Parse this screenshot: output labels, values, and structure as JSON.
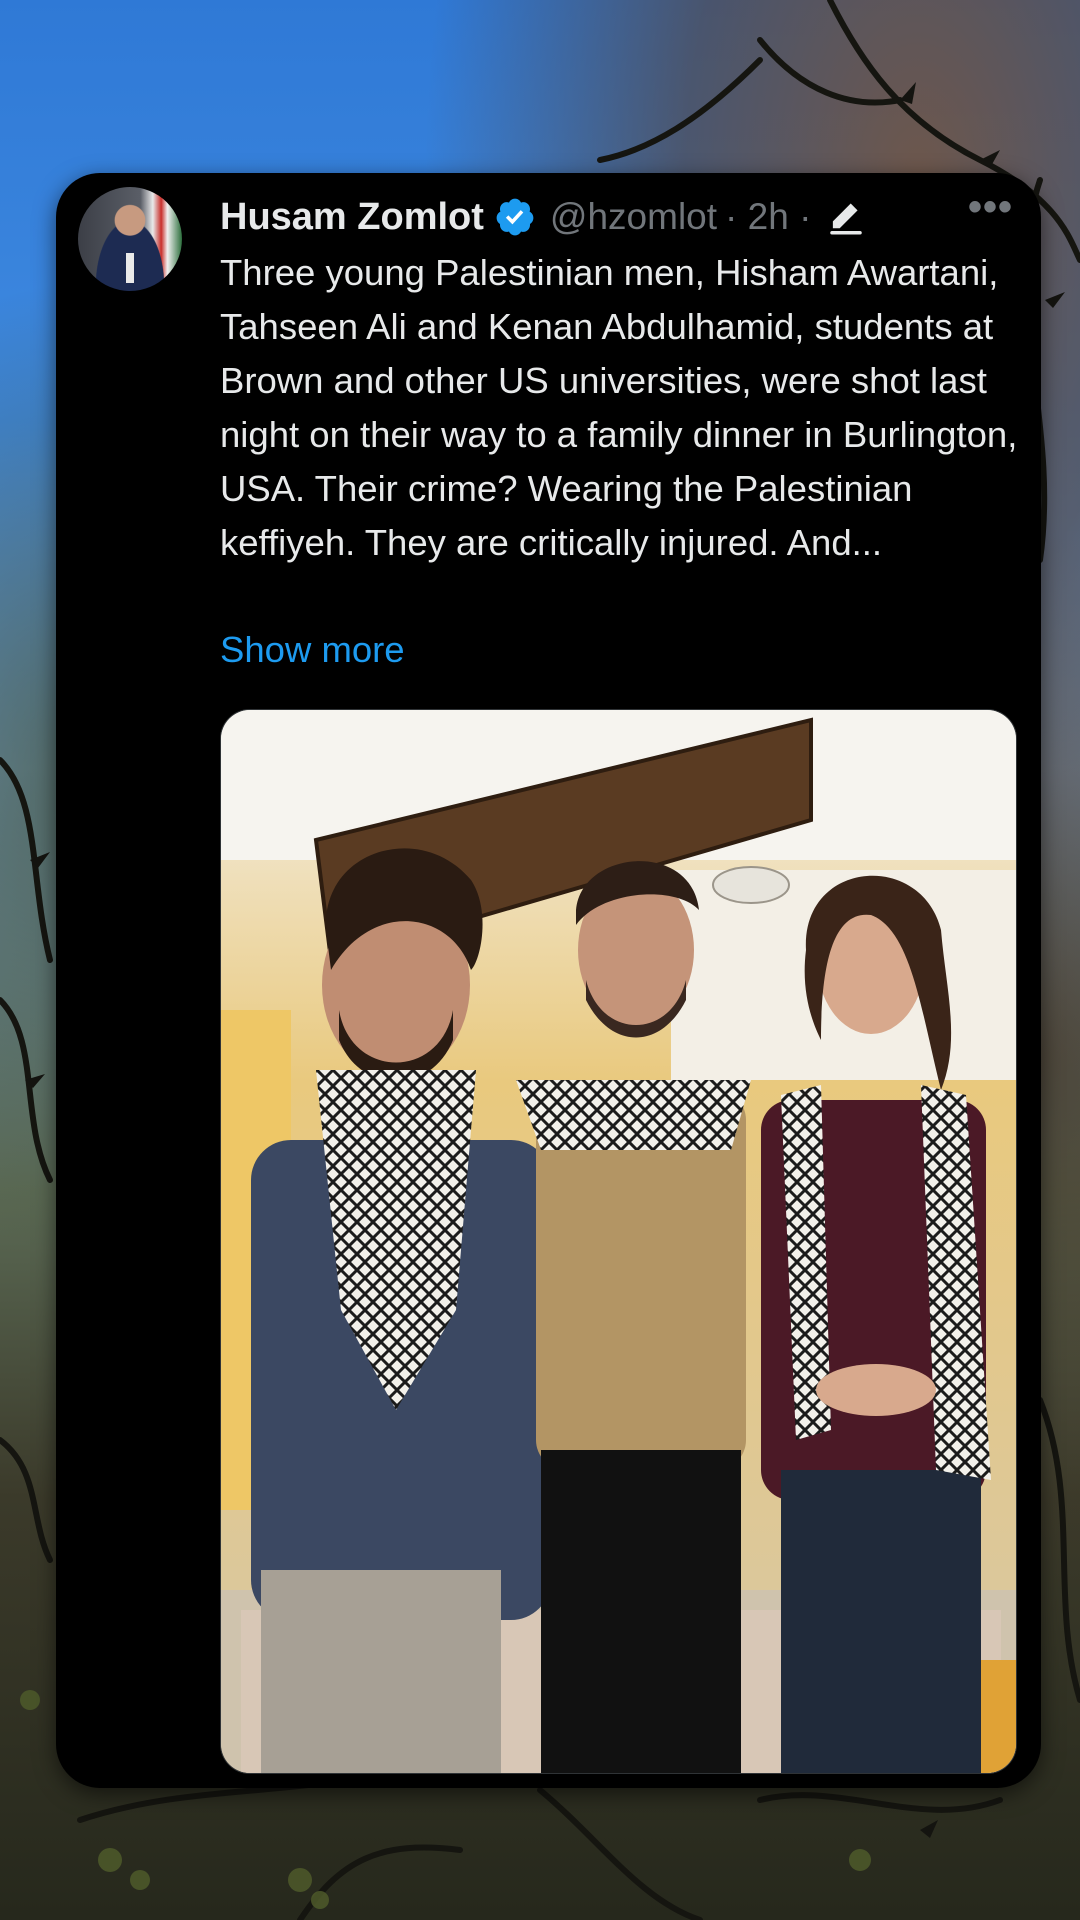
{
  "tweet": {
    "author_name": "Husam Zomlot",
    "handle": "@hzomlot",
    "meta": "· 2h ·",
    "more_label": "•••",
    "body": "Three young Palestinian men, Hisham Awartani, Tahseen Ali and Kenan Abdulhamid, students at Brown and other US universities, were shot last night on their way to a family dinner in Burlington, USA. Their crime? Wearing the Palestinian keffiyeh. They are critically injured. And...",
    "show_more": "Show more",
    "verified_icon": "verified-badge-icon",
    "edit_icon": "edited-pencil-icon"
  },
  "colors": {
    "card_bg": "#000000",
    "primary_text": "#e7e9ea",
    "secondary_text": "#71767b",
    "link": "#1d9bf0",
    "verified": "#1d9bf0"
  }
}
